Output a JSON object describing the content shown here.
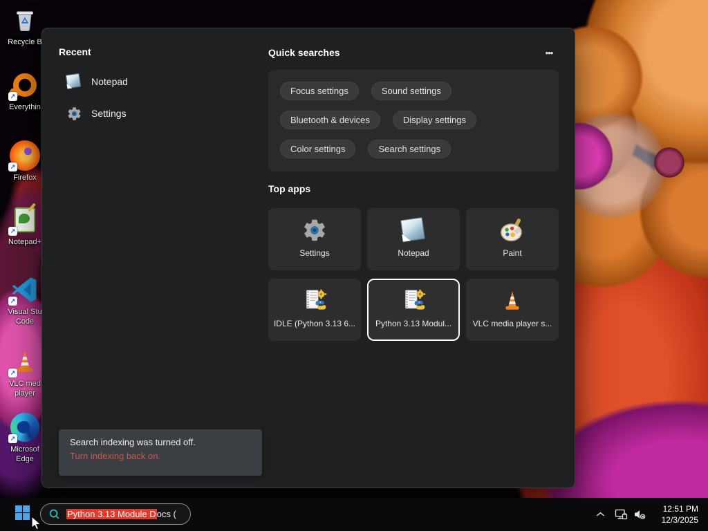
{
  "desktop": {
    "icons": [
      {
        "id": "recycle-bin",
        "label": "Recycle B"
      },
      {
        "id": "everything",
        "label": "Everythin"
      },
      {
        "id": "firefox",
        "label": "Firefox"
      },
      {
        "id": "notepad-plus-plus",
        "label": "Notepad+"
      },
      {
        "id": "visual-studio-code",
        "label": "Visual Stu\nCode"
      },
      {
        "id": "vlc-media-player",
        "label": "VLC med\nplayer"
      },
      {
        "id": "microsoft-edge",
        "label": "Microsof\nEdge"
      }
    ]
  },
  "panel": {
    "recent": {
      "title": "Recent",
      "items": [
        {
          "label": "Notepad"
        },
        {
          "label": "Settings"
        }
      ]
    },
    "quick_searches": {
      "title": "Quick searches",
      "pills": [
        "Focus settings",
        "Sound settings",
        "Bluetooth & devices",
        "Display settings",
        "Color settings",
        "Search settings"
      ]
    },
    "top_apps": {
      "title": "Top apps",
      "tiles": [
        {
          "label": "Settings",
          "selected": false
        },
        {
          "label": "Notepad",
          "selected": false
        },
        {
          "label": "Paint",
          "selected": false
        },
        {
          "label": "IDLE (Python 3.13 6...",
          "selected": false
        },
        {
          "label": "Python 3.13 Modul...",
          "selected": true
        },
        {
          "label": "VLC media player s...",
          "selected": false
        }
      ]
    },
    "notice": {
      "message": "Search indexing was turned off.",
      "action": "Turn indexing back on."
    }
  },
  "taskbar": {
    "search": {
      "selected_text": "Python 3.13 Module D",
      "rest_text": "ocs ("
    },
    "clock": {
      "time": "12:51 PM",
      "date": "12/3/2025"
    }
  },
  "icons": {
    "more_options": "•••",
    "shortcut_arrow": "↗"
  },
  "colors": {
    "accent_blue": "#4fa3e8",
    "selection_red": "#e23a2c",
    "notice_link": "#c95a4f",
    "panel_bg": "#1f2022",
    "card_bg": "#2a2a2b",
    "pill_bg": "#3a3a3b",
    "tile_bg": "#2d2d2e",
    "taskbar_bg": "#0a0a0c"
  }
}
